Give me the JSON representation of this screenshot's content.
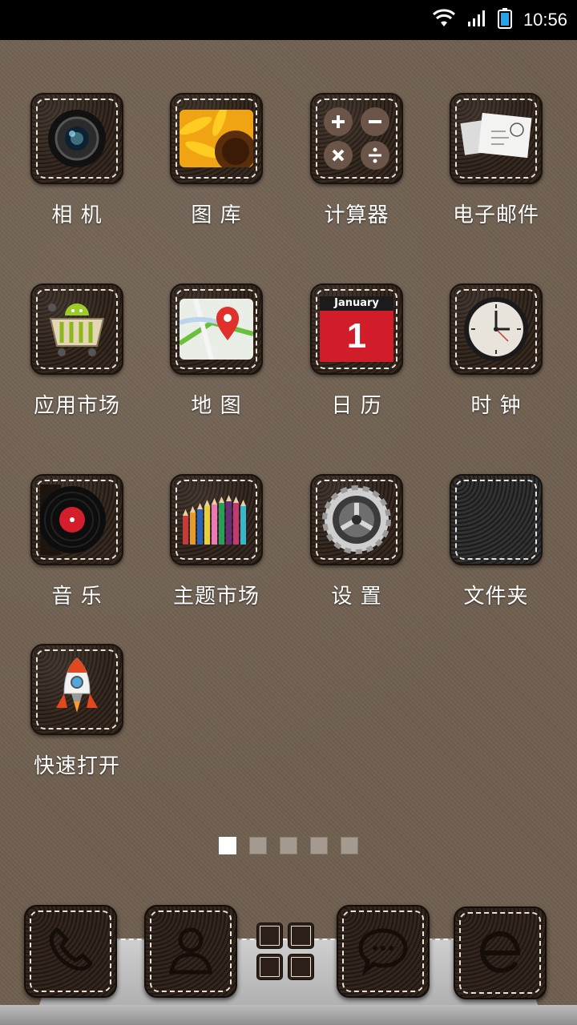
{
  "status_bar": {
    "time": "10:56"
  },
  "apps": [
    {
      "id": "camera",
      "label": "相 机"
    },
    {
      "id": "gallery",
      "label": "图 库"
    },
    {
      "id": "calculator",
      "label": "计算器"
    },
    {
      "id": "email",
      "label": "电子邮件"
    },
    {
      "id": "market",
      "label": "应用市场"
    },
    {
      "id": "maps",
      "label": "地 图"
    },
    {
      "id": "calendar",
      "label": "日 历",
      "month": "January",
      "day": "1"
    },
    {
      "id": "clock",
      "label": "时 钟"
    },
    {
      "id": "music",
      "label": "音 乐"
    },
    {
      "id": "theme-market",
      "label": "主题市场"
    },
    {
      "id": "settings",
      "label": "设 置"
    },
    {
      "id": "folder",
      "label": "文件夹"
    },
    {
      "id": "quick-open",
      "label": "快速打开"
    }
  ],
  "pager": {
    "pages": 5,
    "active": 1
  },
  "dock": {
    "items": [
      "phone",
      "contacts",
      "app-drawer",
      "messaging",
      "browser"
    ]
  },
  "colors": {
    "wallpaper": "#6f6051",
    "tile_leather": "#2f2219",
    "stitch": "#e8e2da",
    "calendar_red": "#d11c2a"
  }
}
